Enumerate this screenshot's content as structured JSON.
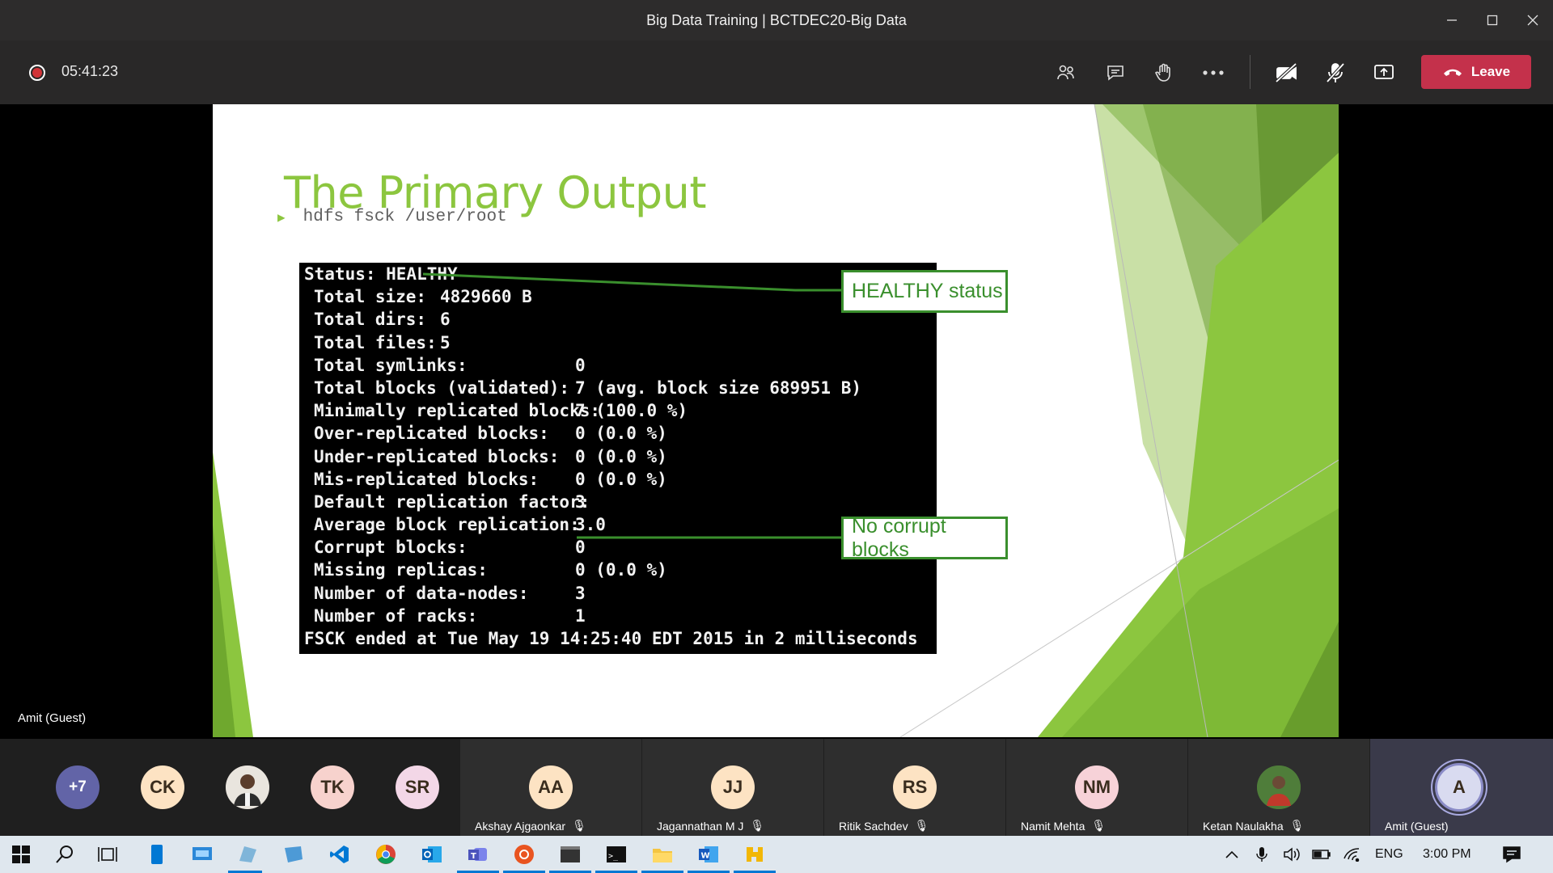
{
  "window": {
    "title": "Big Data Training | BCTDEC20-Big Data",
    "minimize_icon": "minimize-icon",
    "maximize_icon": "maximize-icon",
    "close_icon": "close-icon"
  },
  "meeting": {
    "recording_time": "05:41:23",
    "leave_label": "Leave",
    "accent_color": "#c4314b",
    "toolbar_icons": [
      "people-icon",
      "chat-icon",
      "raise-hand-icon",
      "more-options-icon",
      "camera-off-icon",
      "mic-off-icon",
      "share-screen-icon"
    ]
  },
  "stage": {
    "presenter_name": "Amit (Guest)"
  },
  "slide": {
    "title": "The Primary Output",
    "bullet": "hdfs fsck /user/root",
    "accent_color": "#8cc63f",
    "terminal_lines": [
      {
        "label": "Status: HEALTHY",
        "value": ""
      },
      {
        "label": "Total size:",
        "value": "4829660 B"
      },
      {
        "label": "Total dirs:",
        "value": "6"
      },
      {
        "label": "Total files:",
        "value": "5"
      },
      {
        "label": "Total symlinks:",
        "value": "0"
      },
      {
        "label": "Total blocks (validated):",
        "value": "7 (avg. block size 689951 B)"
      },
      {
        "label": "Minimally replicated blocks:",
        "value": "7 (100.0 %)"
      },
      {
        "label": "Over-replicated blocks:",
        "value": "0 (0.0 %)"
      },
      {
        "label": "Under-replicated blocks:",
        "value": "0 (0.0 %)"
      },
      {
        "label": "Mis-replicated blocks:",
        "value": "0 (0.0 %)"
      },
      {
        "label": "Default replication factor:",
        "value": "3"
      },
      {
        "label": "Average block replication:",
        "value": "3.0"
      },
      {
        "label": "Corrupt blocks:",
        "value": "0"
      },
      {
        "label": "Missing replicas:",
        "value": "0 (0.0 %)"
      },
      {
        "label": "Number of data-nodes:",
        "value": "3"
      },
      {
        "label": "Number of racks:",
        "value": "1"
      },
      {
        "label": "FSCK ended at Tue May 19 14:25:40 EDT 2015 in 2 milliseconds",
        "value": ""
      }
    ],
    "callouts": {
      "healthy": "HEALTHY status",
      "corrupt": "No corrupt blocks"
    }
  },
  "participants": {
    "overflow_count": "+7",
    "small": [
      {
        "initials": "CK",
        "color": "#fde3c3"
      },
      {
        "initials": "",
        "photo": true
      },
      {
        "initials": "TK",
        "color": "#f7d2cd"
      },
      {
        "initials": "SR",
        "color": "#f3d7e7"
      }
    ],
    "tiles": [
      {
        "initials": "AA",
        "name": "Akshay Ajgaonkar",
        "color": "#fde3c3"
      },
      {
        "initials": "JJ",
        "name": "Jagannathan M J",
        "color": "#fde3c3"
      },
      {
        "initials": "RS",
        "name": "Ritik Sachdev",
        "color": "#fde3c3"
      },
      {
        "initials": "NM",
        "name": "Namit Mehta",
        "color": "#f7d2d8"
      },
      {
        "initials": "",
        "name": "Ketan Naulakha",
        "photo": true
      },
      {
        "initials": "A",
        "name": "Amit (Guest)",
        "color": "#d9dbf0"
      }
    ]
  },
  "taskbar": {
    "language": "ENG",
    "time": "3:00 PM"
  }
}
